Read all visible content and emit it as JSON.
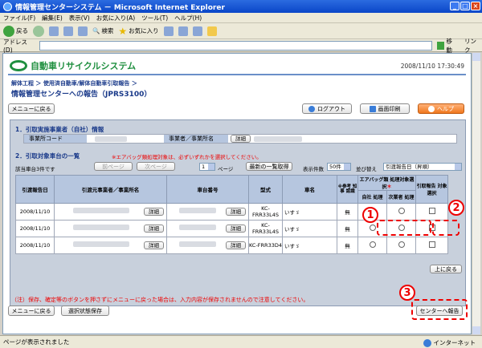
{
  "window": {
    "title": "情報管理センターシステム － Microsoft Internet Explorer",
    "menu": [
      "ファイル(F)",
      "編集(E)",
      "表示(V)",
      "お気に入り(A)",
      "ツール(T)",
      "ヘルプ(H)"
    ],
    "toolbar": {
      "back": "戻る",
      "search": "検索",
      "favorites": "お気に入り"
    },
    "address_label": "アドレス(D)",
    "go_label": "移動",
    "links_label": "リンク",
    "status_text": "ページが表示されました",
    "zone_text": "インターネット"
  },
  "header": {
    "logo_text": "自動車リサイクルシステム",
    "datetime": "2008/11/10  17:30:49",
    "breadcrumb": "解体工程 ＞ 使用済自動車/解体自動車引取報告 ＞",
    "page_title": "情報管理センターへの報告（JPRS3100）"
  },
  "buttons": {
    "menu_back": "メニューに戻る",
    "logout": "ログアウト",
    "print": "画面印刷",
    "help": "ヘルプ",
    "prev_page": "前ページ",
    "next_page": "次ページ",
    "latest_list": "最新の一覧取得",
    "detail": "詳細",
    "back_to_top": "上に戻る",
    "save_selection": "選択状態保存",
    "report_center": "センターへ報告"
  },
  "section1": {
    "title": "1．引取実施事業者（自社）情報",
    "office_code_label": "事業所コード",
    "business_name_label": "事業者／事業所名"
  },
  "section2": {
    "title": "2．引取対象車台の一覧",
    "warning": "※エアバッグ類処理対象は、必ずいずれかを選択してください。",
    "count_text": "該当車台3件です",
    "page_num": "1",
    "page_suffix": "ページ",
    "display_count_label": "表示件数",
    "display_count_value": "50件",
    "sort_label": "並び替え",
    "sort_value": "引渡報告日（昇順）"
  },
  "table": {
    "headers": {
      "date": "引渡報告日",
      "origin": "引渡元事業者／事業所名",
      "chassis": "車台番号",
      "model": "型式",
      "car_name": "車名",
      "reference": "※参考 知事 認識",
      "airbag_group": "エアバッグ類 処理対象選択",
      "airbag_mark": "＊",
      "self": "自社 処理",
      "next": "次業者 処理",
      "report_select": "引取報告 対象選択"
    },
    "rows": [
      {
        "date": "2008/11/10",
        "model": "KC-FRR33L4S",
        "car_name": "いすゞ",
        "ref": "無"
      },
      {
        "date": "2008/11/10",
        "model": "KC-FRR33L4S",
        "car_name": "いすゞ",
        "ref": "無"
      },
      {
        "date": "2008/11/10",
        "model": "KC-FRR33D4",
        "car_name": "いすゞ",
        "ref": "無"
      }
    ]
  },
  "note": "（注）保存、確定等のボタンを押さずにメニューに戻った場合は、入力内容が保存されませんので注意してください。",
  "callouts": [
    "1",
    "2",
    "3"
  ],
  "colors": {
    "accent_red": "#e00000",
    "brand_green": "#1f8f3f",
    "panel_blue": "#c8d0dc",
    "title_blue": "#0a46c8"
  }
}
